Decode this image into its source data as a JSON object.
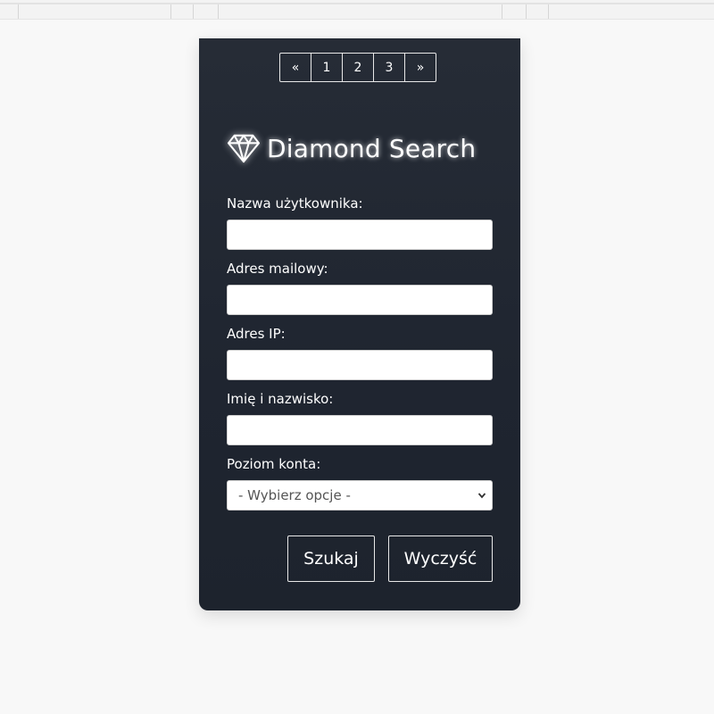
{
  "pagination": {
    "prev": "«",
    "pages": [
      "1",
      "2",
      "3"
    ],
    "next": "»"
  },
  "header": {
    "icon": "diamond-icon",
    "title": "Diamond Search"
  },
  "form": {
    "username": {
      "label": "Nazwa użytkownika:",
      "value": "",
      "placeholder": ""
    },
    "email": {
      "label": "Adres mailowy:",
      "value": "",
      "placeholder": ""
    },
    "ip": {
      "label": "Adres IP:",
      "value": "",
      "placeholder": ""
    },
    "fullname": {
      "label": "Imię i nazwisko:",
      "value": "",
      "placeholder": ""
    },
    "account_level": {
      "label": "Poziom konta:",
      "selected": "- Wybierz opcje -"
    }
  },
  "actions": {
    "search": "Szukaj",
    "clear": "Wyczyść"
  },
  "colors": {
    "card_bg": "#222833",
    "text": "#ffffff",
    "page_bg": "#f8f8f8"
  }
}
